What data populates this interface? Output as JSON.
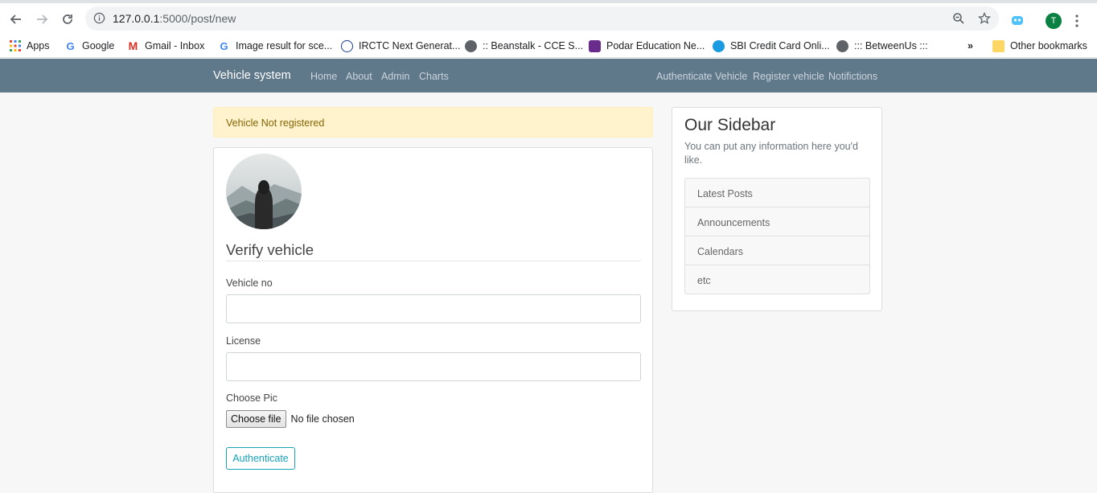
{
  "browser": {
    "url_host": "127.0.0.1",
    "url_path": ":5000/post/new",
    "avatar_letter": "T"
  },
  "bookmarks": {
    "items": [
      {
        "label": "Apps",
        "icon": "apps-grid-icon"
      },
      {
        "label": "Google",
        "icon": "google-icon"
      },
      {
        "label": "Gmail - Inbox",
        "icon": "gmail-icon"
      },
      {
        "label": "Image result for sce...",
        "icon": "google-icon"
      },
      {
        "label": "IRCTC Next Generat...",
        "icon": "irctc-icon"
      },
      {
        "label": ":: Beanstalk - CCE S...",
        "icon": "globe-icon"
      },
      {
        "label": "Podar Education Ne...",
        "icon": "podar-icon"
      },
      {
        "label": "SBI Credit Card Onli...",
        "icon": "sbi-icon"
      },
      {
        "label": "::: BetweenUs :::",
        "icon": "globe-icon"
      }
    ],
    "other": "Other bookmarks",
    "overflow": "»"
  },
  "nav": {
    "brand": "Vehicle system",
    "left_links": [
      "Home",
      "About",
      "Admin",
      "Charts"
    ],
    "right_links": [
      "Authenticate Vehicle",
      "Register vehicle",
      "Notifictions"
    ]
  },
  "alert": {
    "message": "Vehicle Not registered",
    "color": "#856404"
  },
  "form": {
    "legend": "Verify vehicle",
    "vehicle_label": "Vehicle no",
    "vehicle_value": "",
    "license_label": "License",
    "license_value": "",
    "pic_label": "Choose Pic",
    "file_button": "Choose file",
    "file_status": "No file chosen",
    "submit": "Authenticate"
  },
  "sidebar": {
    "title": "Our Sidebar",
    "text": "You can put any information here you'd like.",
    "items": [
      "Latest Posts",
      "Announcements",
      "Calendars",
      "etc"
    ]
  },
  "colors": {
    "navbar": "#5f788a",
    "accent": "#17a2b8",
    "alert_bg": "#fff3cd"
  }
}
